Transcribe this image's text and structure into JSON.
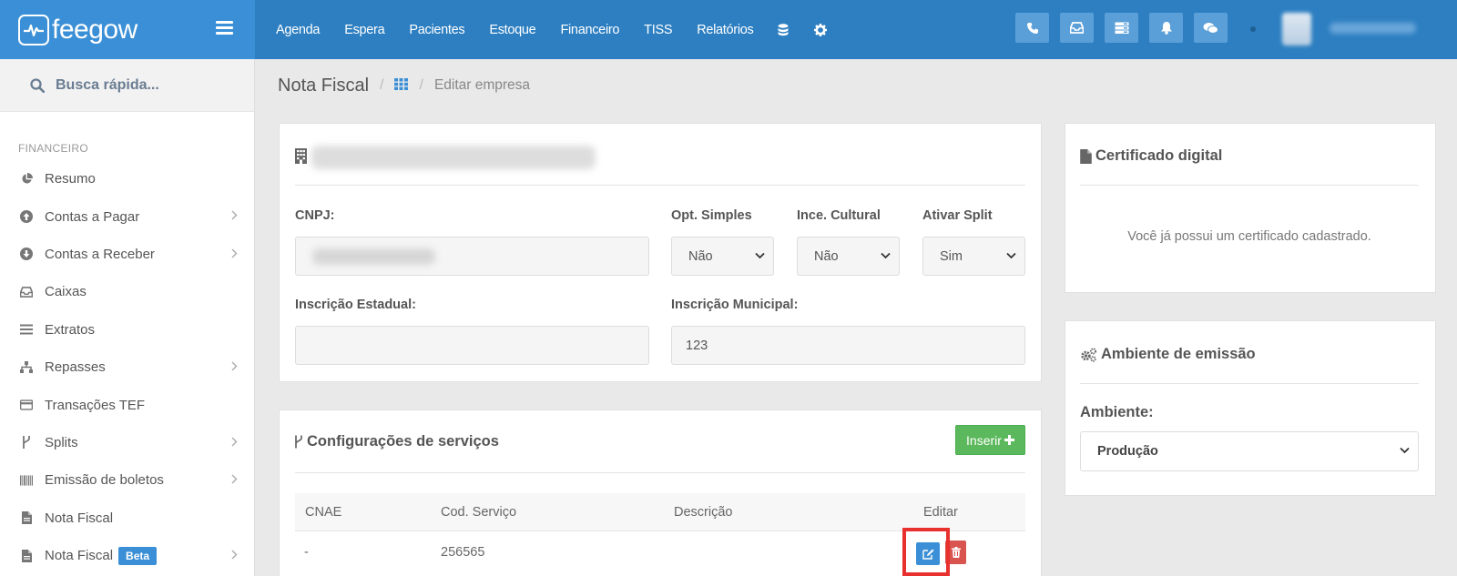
{
  "app": {
    "logo_text": "feegow",
    "brand_color": "#2d7fc1"
  },
  "topnav": {
    "items": [
      "Agenda",
      "Espera",
      "Pacientes",
      "Estoque",
      "Financeiro",
      "TISS",
      "Relatórios"
    ],
    "icons": [
      "database-icon",
      "gear-icon"
    ],
    "actions": [
      "phone-icon",
      "inbox-icon",
      "server-icon",
      "bell-icon",
      "chat-icon"
    ]
  },
  "search": {
    "placeholder": "Busca rápida..."
  },
  "sidebar": {
    "section": "FINANCEIRO",
    "items": [
      {
        "label": "Resumo",
        "icon": "pie-chart-icon",
        "submenu": false
      },
      {
        "label": "Contas a Pagar",
        "icon": "arrow-up-circle-icon",
        "submenu": true
      },
      {
        "label": "Contas a Receber",
        "icon": "arrow-down-circle-icon",
        "submenu": true
      },
      {
        "label": "Caixas",
        "icon": "inbox-icon",
        "submenu": false
      },
      {
        "label": "Extratos",
        "icon": "list-icon",
        "submenu": false
      },
      {
        "label": "Repasses",
        "icon": "sitemap-icon",
        "submenu": true
      },
      {
        "label": "Transações TEF",
        "icon": "credit-card-icon",
        "submenu": false
      },
      {
        "label": "Splits",
        "icon": "branch-icon",
        "submenu": true
      },
      {
        "label": "Emissão de boletos",
        "icon": "barcode-icon",
        "submenu": true
      },
      {
        "label": "Nota Fiscal",
        "icon": "file-icon",
        "submenu": false
      },
      {
        "label": "Nota Fiscal",
        "icon": "file-icon",
        "submenu": true,
        "badge": "Beta"
      }
    ]
  },
  "breadcrumb": {
    "title": "Nota Fiscal",
    "separator": "/",
    "current": "Editar empresa"
  },
  "company": {
    "cnpj_label": "CNPJ:",
    "opt_simples_label": "Opt. Simples",
    "opt_simples_value": "Não",
    "ince_cultural_label": "Ince. Cultural",
    "ince_cultural_value": "Não",
    "ativar_split_label": "Ativar Split",
    "ativar_split_value": "Sim",
    "inscricao_estadual_label": "Inscrição Estadual:",
    "inscricao_estadual_value": "",
    "inscricao_municipal_label": "Inscrição Municipal:",
    "inscricao_municipal_value": "123"
  },
  "services": {
    "title": "Configurações de serviços",
    "insert_label": "Inserir",
    "columns": [
      "CNAE",
      "Cod. Serviço",
      "Descrição",
      "Editar"
    ],
    "rows": [
      {
        "cnae": "-",
        "cod_servico": "256565",
        "descricao": ""
      }
    ]
  },
  "certificate": {
    "title": "Certificado digital",
    "message": "Você já possui um certificado cadastrado."
  },
  "environment": {
    "title": "Ambiente de emissão",
    "label": "Ambiente:",
    "value": "Produção"
  }
}
